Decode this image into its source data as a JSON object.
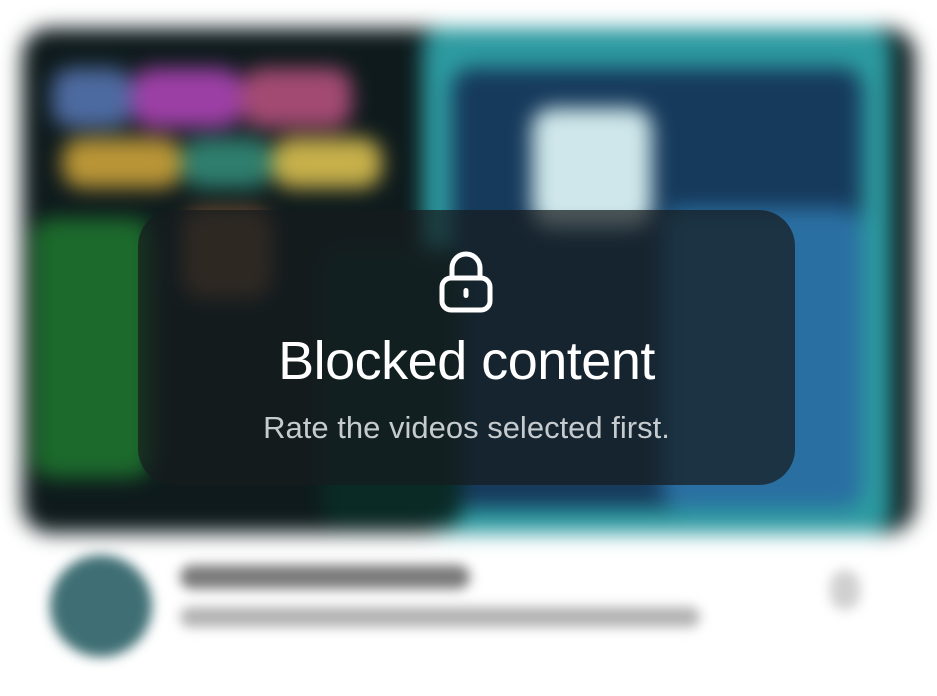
{
  "overlay": {
    "icon": "lock-icon",
    "title": "Blocked content",
    "message": "Rate the videos selected first."
  },
  "colors": {
    "overlay_bg": "#161c1e",
    "title": "#ffffff",
    "subtitle": "#c5cbcf"
  }
}
